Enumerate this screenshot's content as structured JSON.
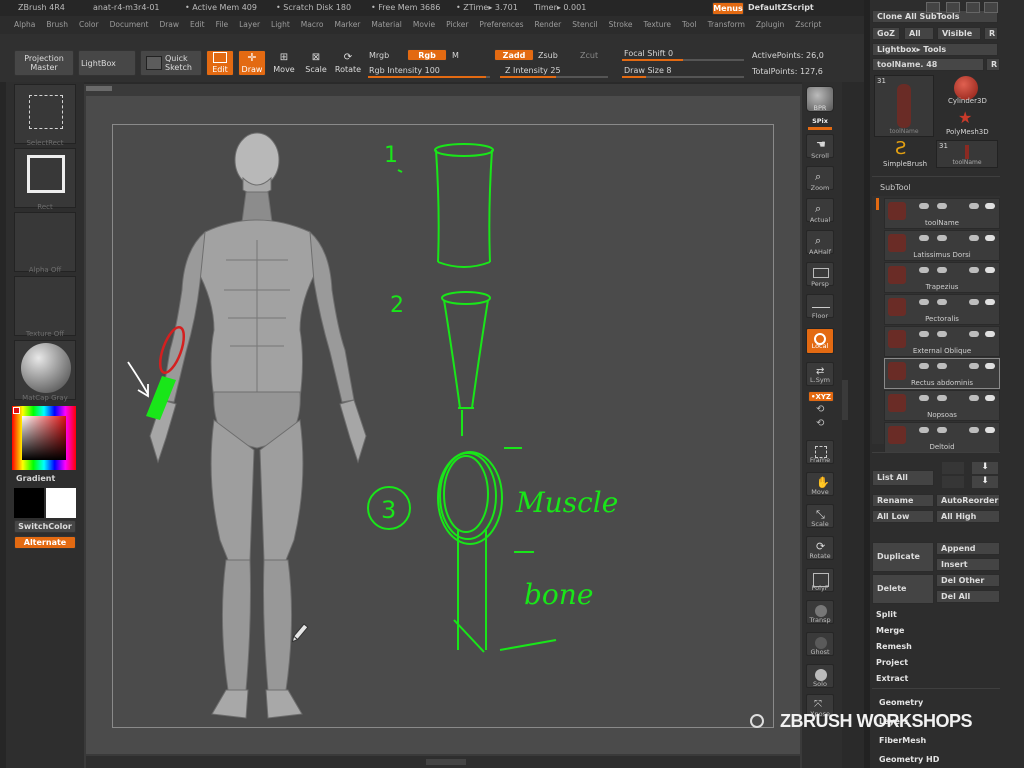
{
  "title_bar": {
    "app": "ZBrush 4R4",
    "document": "anat-r4-m3r4-01",
    "active_mem": "• Active Mem 409",
    "scratch_disk": "• Scratch Disk 180",
    "free_mem": "• Free Mem 3686",
    "ztime": "• ZTime▸ 3.701",
    "timer": "Timer▸ 0.001",
    "menus_button": "Menus",
    "default_zscript": "DefaultZScript"
  },
  "menu_items": [
    "Alpha",
    "Brush",
    "Color",
    "Document",
    "Draw",
    "Edit",
    "File",
    "Layer",
    "Light",
    "Macro",
    "Marker",
    "Material",
    "Movie",
    "Picker",
    "Preferences",
    "Render",
    "Stencil",
    "Stroke",
    "Texture",
    "Tool",
    "Transform",
    "Zplugin",
    "Zscript"
  ],
  "top_shelf": {
    "projection_master": "Projection\nMaster",
    "lightbox": "LightBox",
    "quick_sketch": "Quick\nSketch",
    "edit": "Edit",
    "draw": "Draw",
    "move": "Move",
    "scale": "Scale",
    "rotate": "Rotate",
    "mrgb": "Mrgb",
    "rgb": "Rgb",
    "m": "M",
    "rgb_intensity": "Rgb Intensity 100",
    "zadd": "Zadd",
    "zsub": "Zsub",
    "zcut": "Zcut",
    "z_intensity": "Z Intensity 25",
    "focal_shift": "Focal Shift 0",
    "draw_size": "Draw Size 8",
    "active_points": "ActivePoints: 26,0",
    "total_points": "TotalPoints: 127,6"
  },
  "left_shelf": {
    "select_rect": "SelectRect",
    "rect": "Rect",
    "alpha_off": "Alpha  Off",
    "texture_off": "Texture  Off",
    "matcap_gray": "MatCap  Gray",
    "gradient": "Gradient",
    "switch_color": "SwitchColor",
    "alternate": "Alternate"
  },
  "right_shelf": {
    "bpr": "BPR",
    "spix": "SPix",
    "scroll": "Scroll",
    "zoom": "Zoom",
    "actual": "Actual",
    "aahalf": "AAHalf",
    "persp": "Persp",
    "floor": "Floor",
    "local": "Local",
    "lsym": "L.Sym",
    "xyz": "•XYZ",
    "frame": "Frame",
    "move": "Move",
    "scale": "Scale",
    "rotate": "Rotate",
    "polyf": "PolyF",
    "transp": "Transp",
    "ghost": "Ghost",
    "solo": "Solo",
    "xpose": "Xpose"
  },
  "tool_panel": {
    "clone_all": "Clone  All SubTools",
    "goz": "GoZ",
    "all": "All",
    "visible": "Visible",
    "r": "R",
    "lightbox_tools": "Lightbox▸ Tools",
    "tool_name": "toolName. 48",
    "thumb_count_1": "31",
    "thumb_count_2": "31",
    "cylinder3d": "Cylinder3D",
    "polymesh3d": "PolyMesh3D",
    "simplebrush": "SimpleBrush",
    "toolname_thumb": "toolName",
    "toolname_thumb_1": "toolName"
  },
  "subtool": {
    "header": "SubTool",
    "items": [
      "toolName",
      "Latissimus Dorsi",
      "Trapezius",
      "Pectoralis",
      "External Oblique",
      "Rectus abdominis",
      "Nopsoas",
      "Deltoid"
    ],
    "list_all": "List  All",
    "rename": "Rename",
    "auto_reorder": "AutoReorder",
    "all_low": "All  Low",
    "all_high": "All  High",
    "duplicate": "Duplicate",
    "append": "Append",
    "insert": "Insert",
    "delete": "Delete",
    "del_other": "Del  Other",
    "del_all": "Del  All",
    "split": "Split",
    "merge": "Merge",
    "remesh": "Remesh",
    "project": "Project",
    "extract": "Extract"
  },
  "bottom_panels": [
    "Geometry",
    "Layers",
    "FiberMesh",
    "Geometry HD"
  ],
  "canvas_annotations": {
    "step1": "1",
    "step2": "2",
    "step3": "3",
    "muscle": "Muscle",
    "bone": "bone"
  },
  "watermark": "ZBRUSH WORKSHOPS",
  "colors": {
    "accent_orange": "#e36a12",
    "sketch_green": "#19e619",
    "ring_red": "#d42020"
  }
}
